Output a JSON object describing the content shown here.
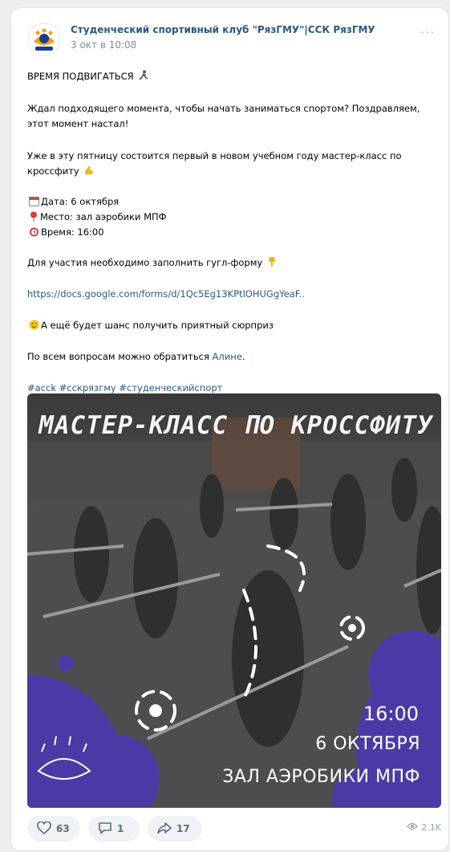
{
  "post": {
    "group_name": "Студенческий спортивный клуб \"РязГМУ\"|ССК РязГМУ",
    "date": "3 окт в 10:08",
    "more_label": "···"
  },
  "text": {
    "l1": "ВРЕМЯ ПОДВИГАТЬСЯ",
    "l2": "Ждал подходящего момента, чтобы начать заниматься спортом? Поздравляем,",
    "l3": "этот момент настал!",
    "l4": "Уже в эту пятницу состоится первый в новом учебном году мастер-класс по",
    "l5": "кроссфиту",
    "l6": "Дата: 6 октября",
    "l7": "Место: зал аэробики МПФ",
    "l8": "Время: 16:00",
    "l9": "Для участия необходимо заполнить гугл-форму",
    "l10_link": "https://docs.google.com/forms/d/1Qc5Eg13KPtlOHUGgYeaF..",
    "l11": "А ещё будет шанс получить приятный сюрприз",
    "l12_prefix": "По всем вопросам можно обратиться ",
    "l12_link": "Алине",
    "l12_suffix": ".",
    "hashtags": "#аcck #сскрязгму #студенческийспорт"
  },
  "image": {
    "title": "МАСТЕР-КЛАСС ПО КРОССФИТУ",
    "time": "16:00",
    "date": "6 ОКТЯБРЯ",
    "place": "ЗАЛ АЭРОБИКИ МПФ"
  },
  "actions": {
    "likes": "63",
    "comments": "1",
    "shares": "17",
    "views": "2.1K"
  },
  "icons": {
    "like": "heart-icon",
    "comment": "comment-icon",
    "share": "share-icon",
    "views": "eye-icon"
  },
  "colors": {
    "link": "#2a5885",
    "purple": "#4b3aa6",
    "pill_bg": "#f0f2f5"
  }
}
